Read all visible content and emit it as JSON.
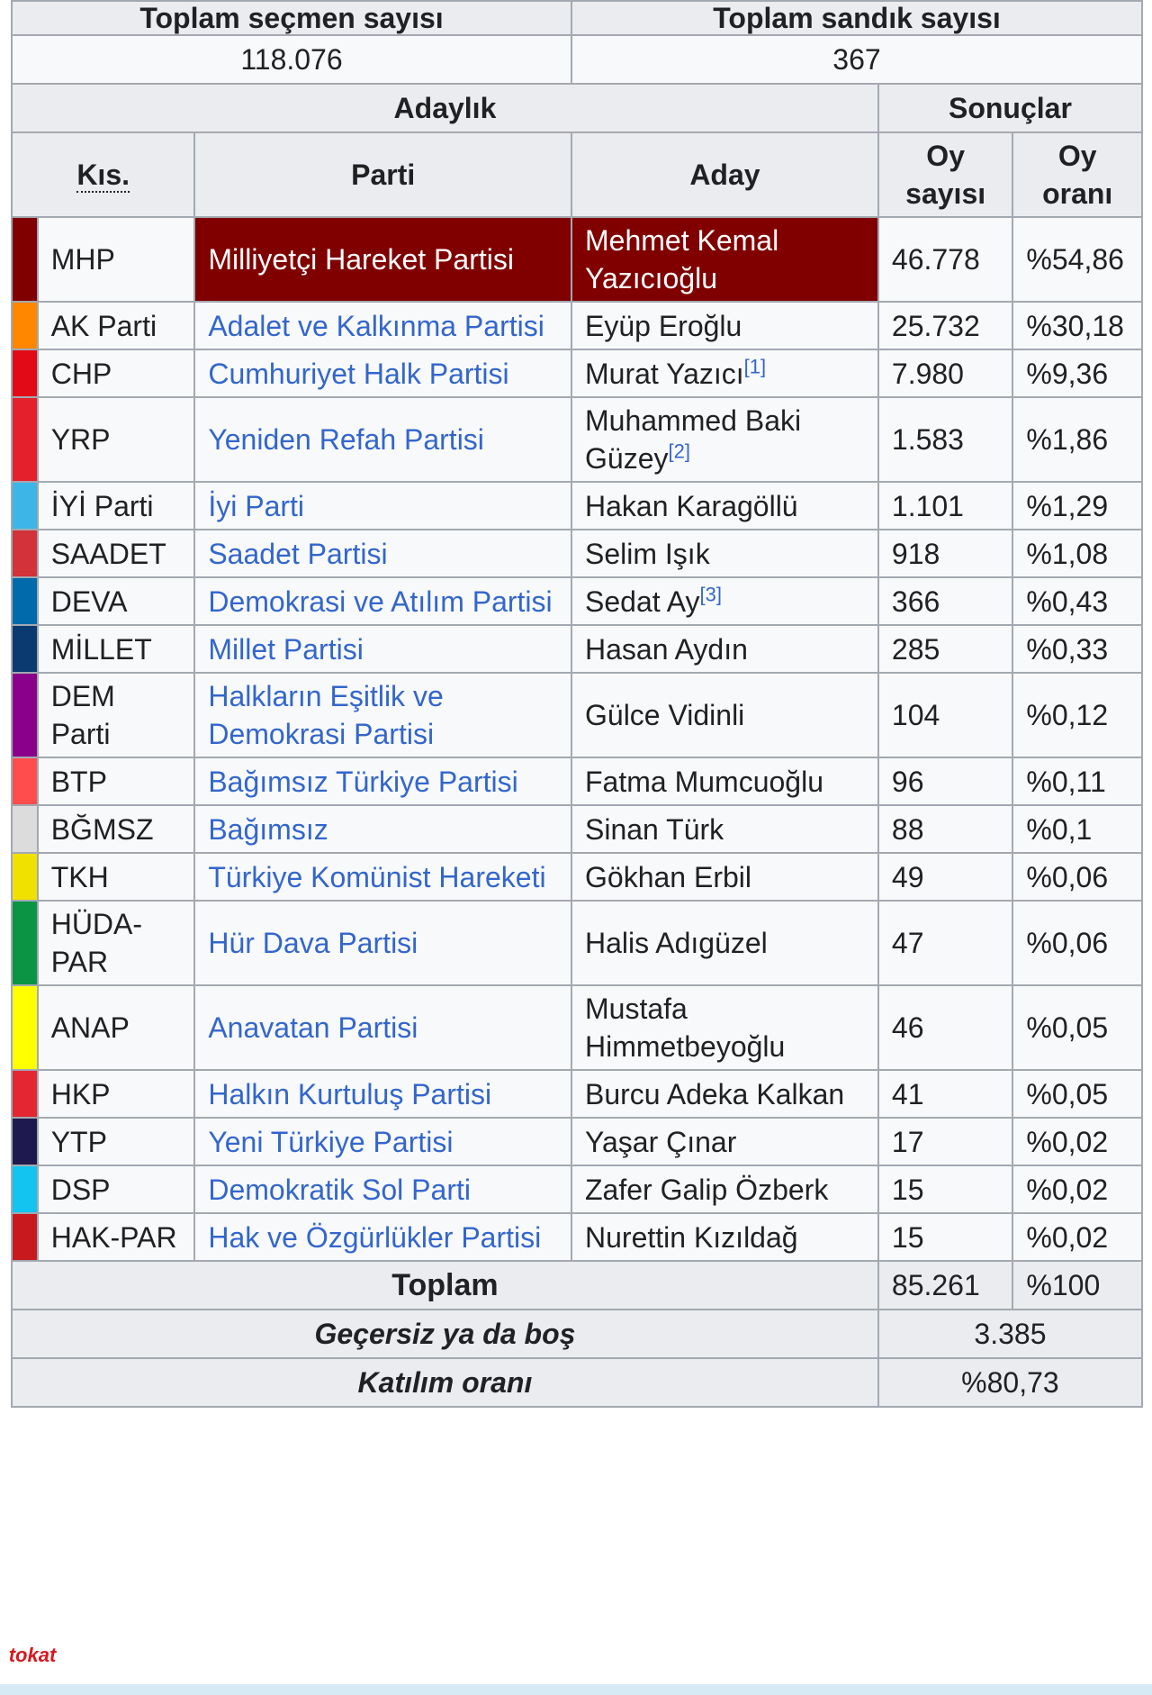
{
  "summary": {
    "voters_label": "Toplam seçmen sayısı",
    "ballots_label": "Toplam sandık sayısı",
    "voters_value": "118.076",
    "ballots_value": "367"
  },
  "headers": {
    "candidacy": "Adaylık",
    "results": "Sonuçlar",
    "abbr": "Kıs.",
    "party": "Parti",
    "candidate": "Aday",
    "votes_l1": "Oy",
    "votes_l2": "sayısı",
    "share_l1": "Oy",
    "share_l2": "oranı"
  },
  "rows": [
    {
      "color": "#800000",
      "abbr": "MHP",
      "party": "Milliyetçi Hareket Partisi",
      "candidate": "Mehmet Kemal Yazıcıoğlu",
      "ref": "",
      "votes": "46.778",
      "share": "%54,86",
      "highlight": true
    },
    {
      "color": "#FF8700",
      "abbr": "AK Parti",
      "party": "Adalet ve Kalkınma Partisi",
      "candidate": "Eyüp Eroğlu",
      "ref": "",
      "votes": "25.732",
      "share": "%30,18"
    },
    {
      "color": "#E30A17",
      "abbr": "CHP",
      "party": "Cumhuriyet Halk Partisi",
      "candidate": "Murat Yazıcı",
      "ref": "[1]",
      "votes": "7.980",
      "share": "%9,36"
    },
    {
      "color": "#E4202C",
      "abbr": "YRP",
      "party": "Yeniden Refah Partisi",
      "candidate": "Muhammed Baki Güzey",
      "ref": "[2]",
      "votes": "1.583",
      "share": "%1,86"
    },
    {
      "color": "#3DB5E6",
      "abbr": "İYİ Parti",
      "party": "İyi Parti",
      "candidate": "Hakan Karagöllü",
      "ref": "",
      "votes": "1.101",
      "share": "%1,29"
    },
    {
      "color": "#D3323A",
      "abbr": "SAADET",
      "party": "Saadet Partisi",
      "candidate": "Selim Işık",
      "ref": "",
      "votes": "918",
      "share": "%1,08"
    },
    {
      "color": "#006AAB",
      "abbr": "DEVA",
      "party": "Demokrasi ve Atılım Partisi",
      "candidate": "Sedat Ay",
      "ref": "[3]",
      "votes": "366",
      "share": "%0,43"
    },
    {
      "color": "#0A3A70",
      "abbr": "MİLLET",
      "party": "Millet Partisi",
      "candidate": "Hasan Aydın",
      "ref": "",
      "votes": "285",
      "share": "%0,33"
    },
    {
      "color": "#8B008B",
      "abbr": "DEM Parti",
      "party": "Halkların Eşitlik ve Demokrasi Partisi",
      "candidate": "Gülce Vidinli",
      "ref": "",
      "votes": "104",
      "share": "%0,12"
    },
    {
      "color": "#FF4D4D",
      "abbr": "BTP",
      "party": "Bağımsız Türkiye Partisi",
      "candidate": "Fatma Mumcuoğlu",
      "ref": "",
      "votes": "96",
      "share": "%0,11"
    },
    {
      "color": "#DCDCDC",
      "abbr": "BĞMSZ",
      "party": "Bağımsız",
      "candidate": "Sinan Türk",
      "ref": "",
      "votes": "88",
      "share": "%0,1"
    },
    {
      "color": "#F1E100",
      "abbr": "TKH",
      "party": "Türkiye Komünist Hareketi",
      "candidate": "Gökhan Erbil",
      "ref": "",
      "votes": "49",
      "share": "%0,06"
    },
    {
      "color": "#0B9444",
      "abbr": "HÜDA-PAR",
      "party": "Hür Dava Partisi",
      "candidate": "Halis Adıgüzel",
      "ref": "",
      "votes": "47",
      "share": "%0,06"
    },
    {
      "color": "#FFFF00",
      "abbr": "ANAP",
      "party": "Anavatan Partisi",
      "candidate": "Mustafa Himmetbeyoğlu",
      "ref": "",
      "votes": "46",
      "share": "%0,05"
    },
    {
      "color": "#E42532",
      "abbr": "HKP",
      "party": "Halkın Kurtuluş Partisi",
      "candidate": "Burcu Adeka Kalkan",
      "ref": "",
      "votes": "41",
      "share": "%0,05"
    },
    {
      "color": "#1F1A4D",
      "abbr": "YTP",
      "party": "Yeni Türkiye Partisi",
      "candidate": "Yaşar Çınar",
      "ref": "",
      "votes": "17",
      "share": "%0,02"
    },
    {
      "color": "#13C4F1",
      "abbr": "DSP",
      "party": "Demokratik Sol Parti",
      "candidate": "Zafer Galip Özberk",
      "ref": "",
      "votes": "15",
      "share": "%0,02"
    },
    {
      "color": "#C8191F",
      "abbr": "HAK-PAR",
      "party": "Hak ve Özgürlükler Partisi",
      "candidate": "Nurettin Kızıldağ",
      "ref": "",
      "votes": "15",
      "share": "%0,02"
    }
  ],
  "totals": {
    "total_label": "Toplam",
    "total_votes": "85.261",
    "total_share": "%100",
    "invalid_label": "Geçersiz ya da boş",
    "invalid_value": "3.385",
    "turnout_label": "Katılım oranı",
    "turnout_value": "%80,73"
  },
  "logo_text": "tokat"
}
